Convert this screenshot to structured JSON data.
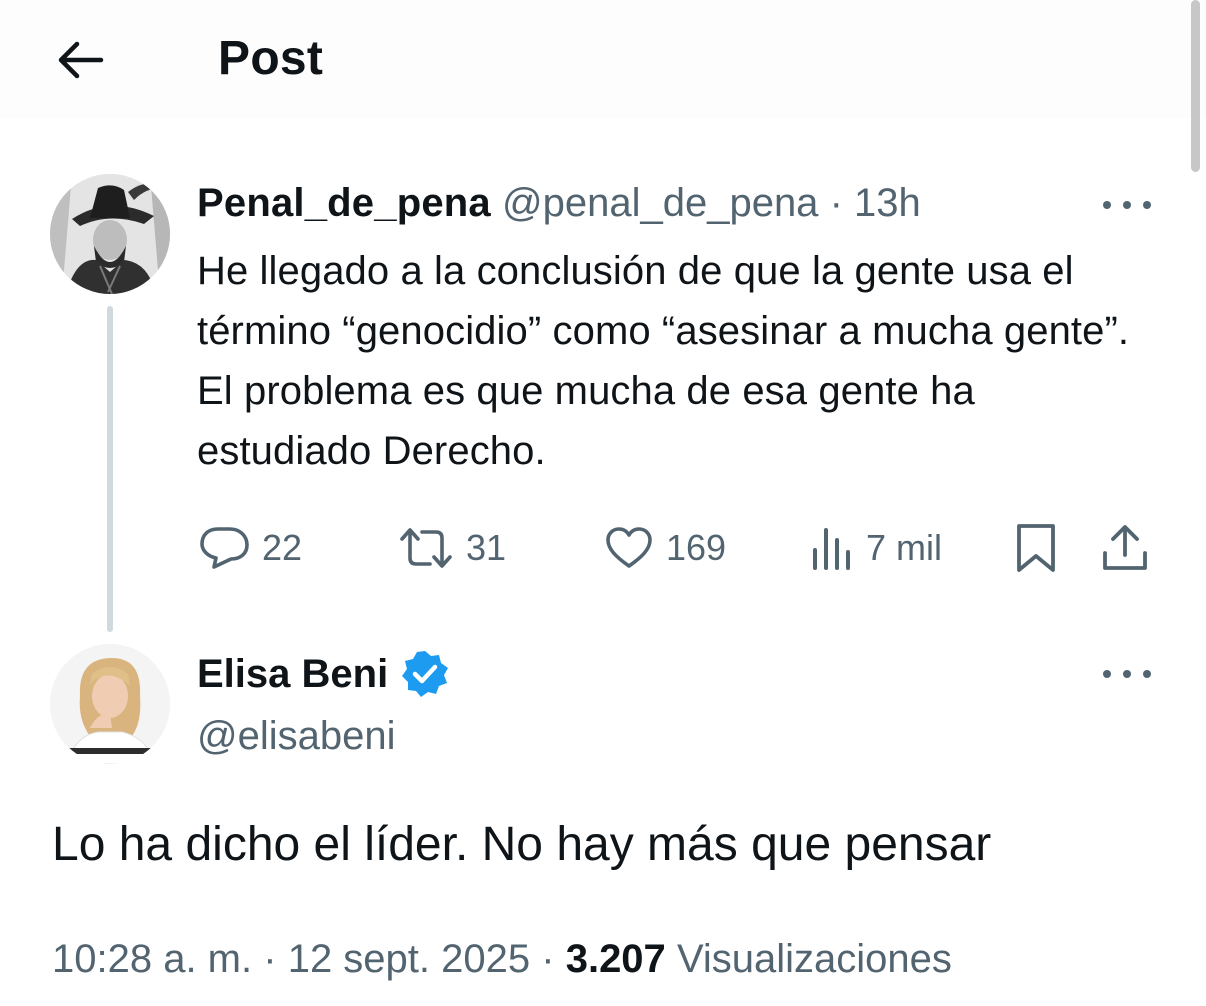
{
  "header": {
    "title": "Post",
    "back_icon": "arrow-left-icon"
  },
  "quoted_post": {
    "display_name": "Penal_de_pena",
    "handle": "@penal_de_pena",
    "separator": "·",
    "time": "13h",
    "text": "He llegado a la conclusión de que la gente usa el término “genocidio” como “asesinar a mucha gente”. El problema es que mucha de esa gente ha estudiado Derecho.",
    "actions": {
      "replies": "22",
      "reposts": "31",
      "likes": "169",
      "views": "7 mil"
    }
  },
  "main_post": {
    "display_name": "Elisa Beni",
    "verified": true,
    "handle": "@elisabeni",
    "text": "Lo ha dicho el líder. No hay más que pensar",
    "time": "10:28 a. m.",
    "separator": "·",
    "date": "12 sept. 2025",
    "views_count": "3.207",
    "views_label": "Visualizaciones"
  },
  "colors": {
    "text_primary": "#0f1419",
    "text_secondary": "#536471",
    "verified_blue": "#1d9bf0",
    "thread_line": "#cfd9de"
  }
}
